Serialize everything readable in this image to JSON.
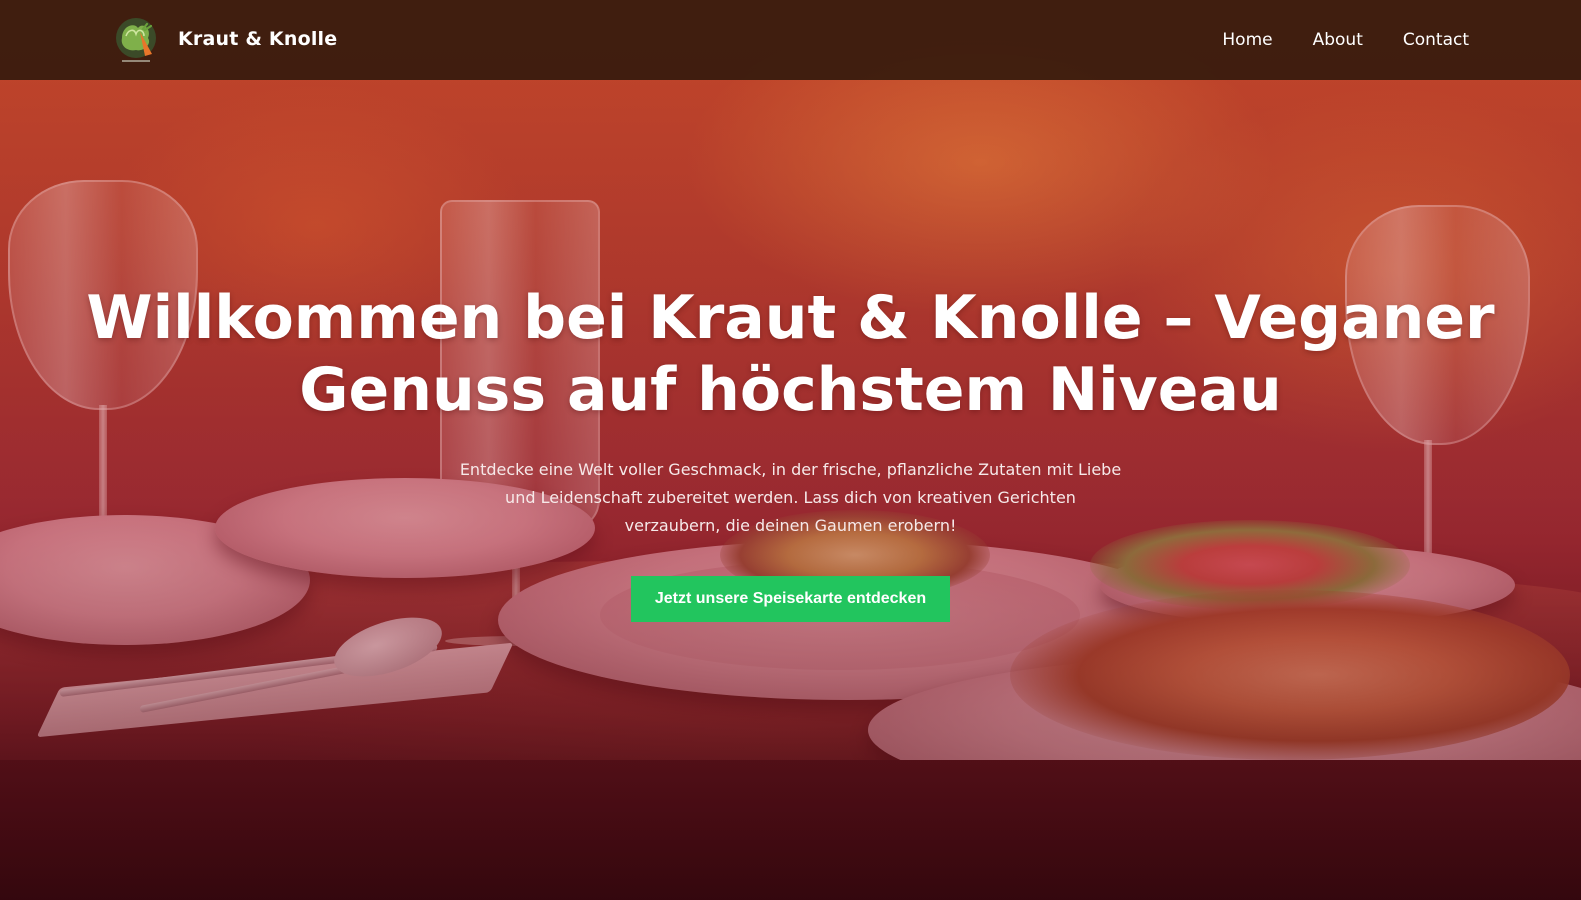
{
  "brand": {
    "name": "Kraut & Knolle",
    "logo_icon": "vegetable-logo-icon"
  },
  "nav": {
    "items": [
      {
        "label": "Home"
      },
      {
        "label": "About"
      },
      {
        "label": "Contact"
      }
    ]
  },
  "hero": {
    "title": "Willkommen bei Kraut & Knolle – Veganer Genuss auf höchstem Niveau",
    "text": "Entdecke eine Welt voller Geschmack, in der frische, pflanzliche Zutaten mit Liebe und Leidenschaft zubereitet werden. Lass dich von kreativen Gerichten verzaubern, die deinen Gaumen erobern!",
    "cta_label": "Jetzt unsere Speisekarte entdecken"
  },
  "colors": {
    "navbar": "#32190c",
    "cta": "#22c55e",
    "overlay_tone": "#b4281e"
  }
}
